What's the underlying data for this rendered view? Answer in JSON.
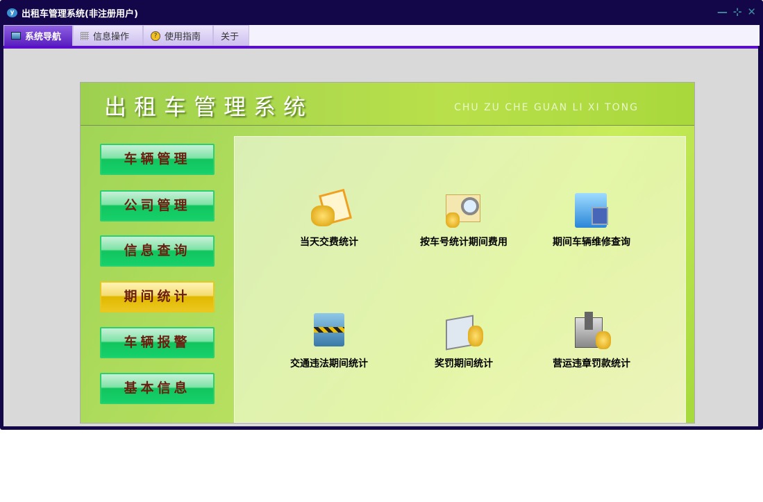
{
  "window": {
    "title": "出租车管理系统(非注册用户)"
  },
  "tabs": [
    {
      "label": "系统导航"
    },
    {
      "label": "信息操作"
    },
    {
      "label": "使用指南"
    },
    {
      "label": "关于"
    }
  ],
  "header": {
    "title": "出租车管理系统",
    "pinyin": "CHU ZU CHE GUAN LI XI TONG"
  },
  "menu": [
    {
      "label": "车辆管理"
    },
    {
      "label": "公司管理"
    },
    {
      "label": "信息查询"
    },
    {
      "label": "期间统计",
      "selected": true
    },
    {
      "label": "车辆报警"
    },
    {
      "label": "基本信息"
    }
  ],
  "items": [
    {
      "label": "当天交费统计"
    },
    {
      "label": "按车号统计期间费用"
    },
    {
      "label": "期间车辆维修查询"
    },
    {
      "label": "交通违法期间统计"
    },
    {
      "label": "奖罚期间统计"
    },
    {
      "label": "营运违章罚款统计"
    }
  ]
}
